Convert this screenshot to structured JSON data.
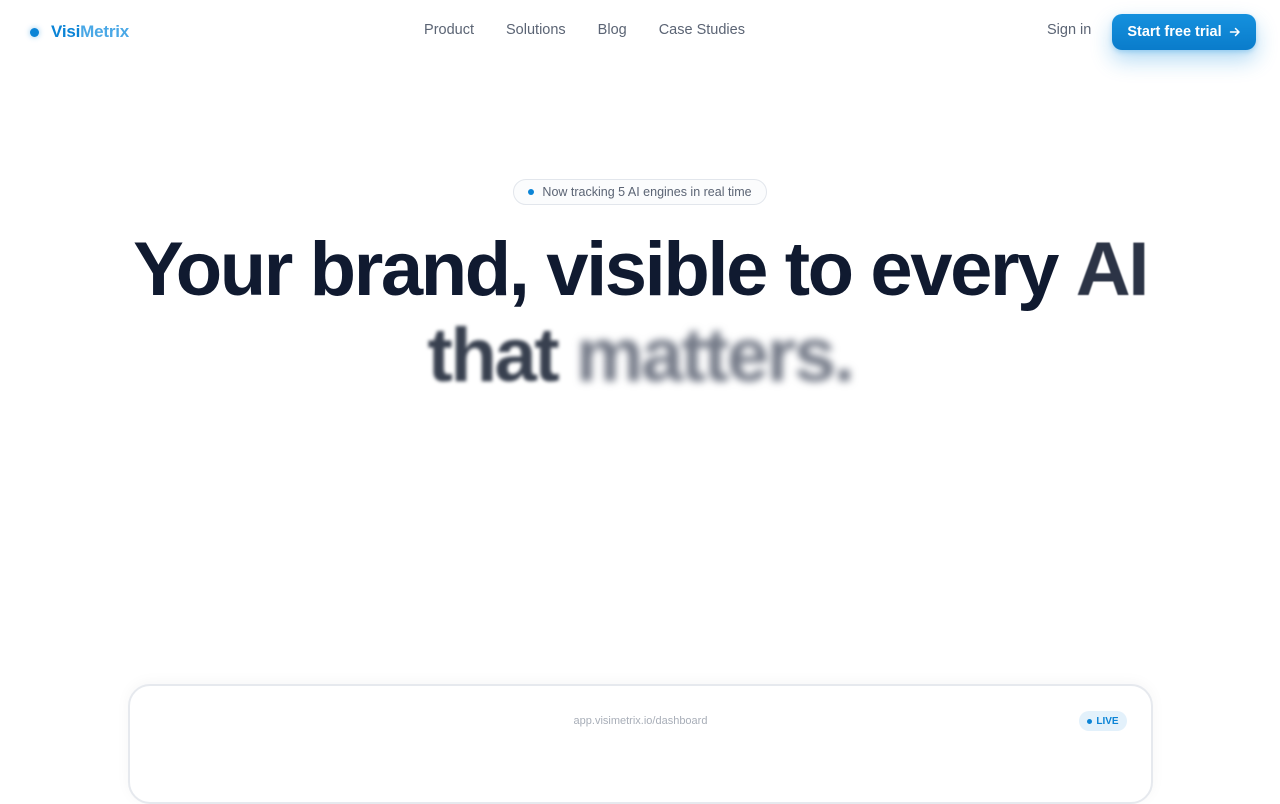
{
  "brand": {
    "name_a": "Visi",
    "name_b": "Metrix",
    "color": "#0b84d6"
  },
  "nav": {
    "links": [
      "Product",
      "Solutions",
      "Blog",
      "Case Studies"
    ],
    "sign_in": "Sign in",
    "cta_label": "Start free trial",
    "cta_icon": "arrow-right-icon"
  },
  "hero": {
    "badge": "Now tracking 5 AI engines in real time",
    "headline_line1": "Your brand, visible to every",
    "headline_line1_end": "AI",
    "headline_line2_a": "that",
    "headline_line2_b": "matters."
  },
  "preview": {
    "url": "app.visimetrix.io/dashboard",
    "live": "LIVE"
  }
}
